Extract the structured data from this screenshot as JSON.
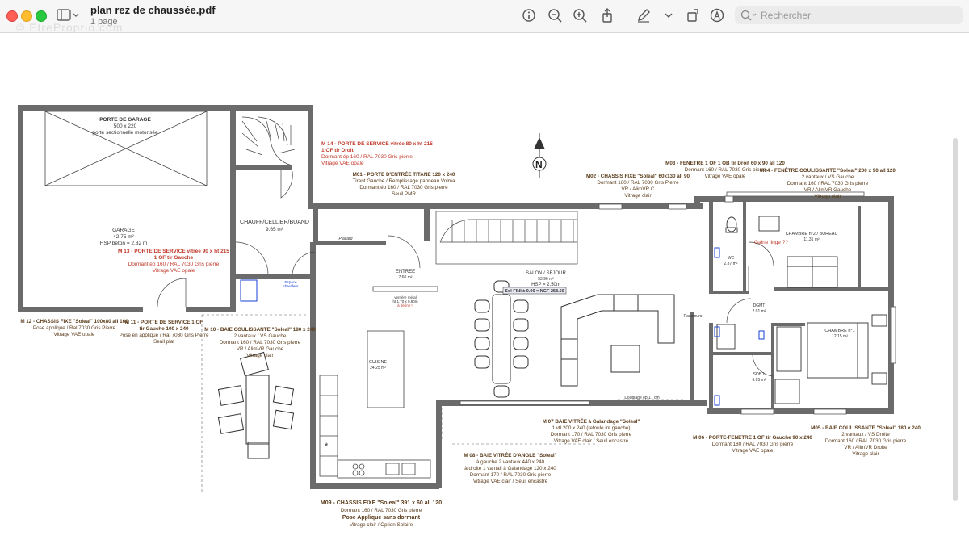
{
  "window": {
    "file_name": "plan rez de chaussée.pdf",
    "pages": "1 page",
    "search_placeholder": "Rechercher",
    "watermark": "© EtreProprio.com"
  },
  "plan": {
    "rooms": {
      "garage_door": [
        "PORTE DE GARAGE",
        "500 x 220",
        "porte sectionnelle motorisée"
      ],
      "garage": [
        "GARAGE",
        "42.75 m²",
        "HSP béton = 2.82 m"
      ],
      "chauff": [
        "CHAUFF/CELLIER/BUAND",
        "9.65 m²"
      ],
      "entree": [
        "ENTREE",
        "7.60 m²"
      ],
      "salon": [
        "SALON / SEJOUR",
        "53.96 m²",
        "HSP = 2.50m"
      ],
      "nqf": "Sol FINI ± 0.00 = NGF 258.50",
      "cuisine": [
        "CUISINE",
        "24.25 m²"
      ],
      "verriere": [
        "verrière métal",
        "ht 1.70 x 0.80m",
        "à définir !!"
      ],
      "wc": [
        "WC",
        "2.87 m²"
      ],
      "dgmt": [
        "DGMT",
        "2.01 m²"
      ],
      "chambre2": [
        "CHAMBRE n°2 / BUREAU",
        "11.31 m²"
      ],
      "gaine": "Gaine linge ??",
      "chambre1": [
        "CHAMBRE n°1",
        "12.15 m²"
      ],
      "sdb": [
        "SDB 1",
        "6.05 m²"
      ],
      "rasomuro": "Rasomuro",
      "espace": [
        "Espace",
        "chauffeur"
      ],
      "placard": "Placard",
      "doublage": "Doublage ép 17 cm"
    },
    "notes_red": {
      "m14": [
        "M 14 - PORTE DE SERVICE vitrée 80 x ht 215",
        "1 OF tir Droit",
        "Dormant ép 160 / RAL 7030 Gris pierre",
        "Vitrage VAE opale"
      ],
      "m13": [
        "M 13 - PORTE DE SERVICE vitrée 90 x ht 215",
        "1 OF tir Gauche",
        "Dormant ép 160 / RAL 7030 Gris pierre",
        "Vitrage VAE opale"
      ]
    },
    "notes": {
      "m01": [
        "M01 - PORTE D'ENTRÉE TITANE 120 x 240",
        "Tirant Gauche / Remplissage panneau Volma",
        "Dormant ép 160 / RAL 7030 Gris pierre",
        "Seuil PMR"
      ],
      "m02": [
        "M02 - CHASSIS FIXE \"Soleal\" 60x130 all 90",
        "Dormant 160 / RAL 7030 Gris Pierre",
        "VR / AlimVR C",
        "Vitrage clair"
      ],
      "m03": [
        "M03 - FENETRE 1 OF 1 OB tir Droit 60 x 90 all 120",
        "Dormant 160 / RAL 7030 Gris pierre",
        "Vitrage VAE opale"
      ],
      "m04": [
        "M04 - FENÊTRE COULISSANTE \"Soleal\" 200 x 90 all 120",
        "2 vantaux / VS Gauche",
        "Dormant 160 / RAL 7030 Gris pierre",
        "VR / AlimVR Gauche",
        "Vitrage clair"
      ],
      "m12": [
        "M 12 - CHASSIS FIXE \"Soleal\" 100x80 all 160",
        "Pose applique / Ral 7030 Gris Pierre",
        "Vitrage VAE opale"
      ],
      "m11": [
        "M 11 - PORTE DE SERVICE 1 OF",
        "tir Gauche 100 x 240",
        "Pose en applique / Ral 7030 Gris Pierre",
        "Seuil plat"
      ],
      "m10": [
        "M 10 - BAIE COULISSANTE \"Soleal\" 180 x 240",
        "2 vantaux / VS Gauche",
        "Dormant 160 / RAL 7030 Gris pierre",
        "VR / AlimVR Gauche",
        "Vitrage clair"
      ],
      "m07": [
        "M 07 BAIE VITRÉE à Galandage \"Soleal\"",
        "1 vtl 200 x 240 (refoule int gauche)",
        "Dormant 170 / RAL 7030 Gris pierre",
        "Vitrage VAE clair / Seuil encastré"
      ],
      "m08": [
        "M 08 - BAIE VITRÉE D'ANGLE \"Soleal\"",
        "à gauche 2 vantaux 440 x 240",
        "à droite 1 vantail à Galandage 120 x 240",
        "Dormant 170 / RAL 7030 Gris pierre",
        "Vitrage VAE clair / Seuil encastré"
      ],
      "m06": [
        "M 06 - PORTE-FENETRE 1 OF tir Gauche 90 x 240",
        "Dormant 180 / RAL 7030 Gris pierre",
        "Vitrage VAE opale"
      ],
      "m05": [
        "M05 - BAIE COULISSANTE \"Soleal\" 180 x 240",
        "2 vantaux / VS Droite",
        "Dormant 160 / RAL 7030 Gris pierre",
        "VR / AlimVR Droite",
        "Vitrage clair"
      ],
      "m09": [
        "M09 - CHASSIS FIXE \"Soleal\" 391 x 60 all 120",
        "Dormant 160 / RAL 7030 Gris pierre",
        "Pose Applique sans dormant",
        "Vitrage clair / Option Solaire"
      ]
    },
    "north": "N"
  },
  "colors": {
    "wall": "#555555",
    "note": "#5a3b1a",
    "red": "#c0392b",
    "blue": "#1a3fd6"
  }
}
